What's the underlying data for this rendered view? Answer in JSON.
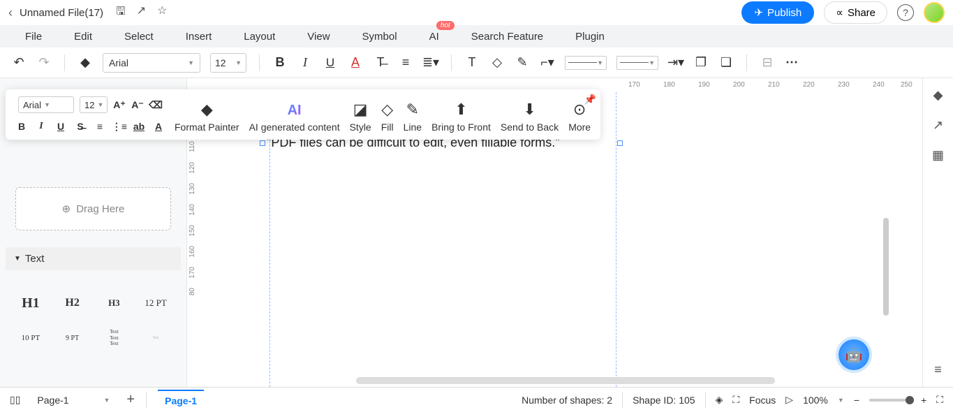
{
  "titleBar": {
    "filename": "Unnamed File(17)",
    "publish": "Publish",
    "share": "Share"
  },
  "menu": {
    "items": [
      "File",
      "Edit",
      "Select",
      "Insert",
      "Layout",
      "View",
      "Symbol",
      "AI",
      "Search Feature",
      "Plugin"
    ],
    "hotIndex": 7,
    "hotLabel": "hot"
  },
  "toolbar1": {
    "font": "Arial",
    "size": "12"
  },
  "floatToolbar": {
    "font": "Arial",
    "size": "12",
    "items": [
      "Format Painter",
      "AI generated content",
      "Style",
      "Fill",
      "Line",
      "Bring to Front",
      "Send to Back",
      "More"
    ]
  },
  "leftPanel": {
    "collect": "collect",
    "dragHere": "Drag Here",
    "textSection": "Text",
    "cells": [
      "H1",
      "H2",
      "H3",
      "12 PT",
      "10 PT",
      "9 PT"
    ]
  },
  "canvas": {
    "textContent": "\"PDF files can be difficult to edit, even fillable forms.\"",
    "rulerH": [
      170,
      180,
      190,
      200,
      210,
      220,
      230,
      240,
      250
    ],
    "rulerV": [
      110,
      120,
      130,
      140,
      150,
      160,
      170,
      80
    ]
  },
  "statusBar": {
    "pageDropdown": "Page-1",
    "pageTab": "Page-1",
    "shapesCount": "Number of shapes: 2",
    "shapeId": "Shape ID: 105",
    "focus": "Focus",
    "zoom": "100%"
  }
}
